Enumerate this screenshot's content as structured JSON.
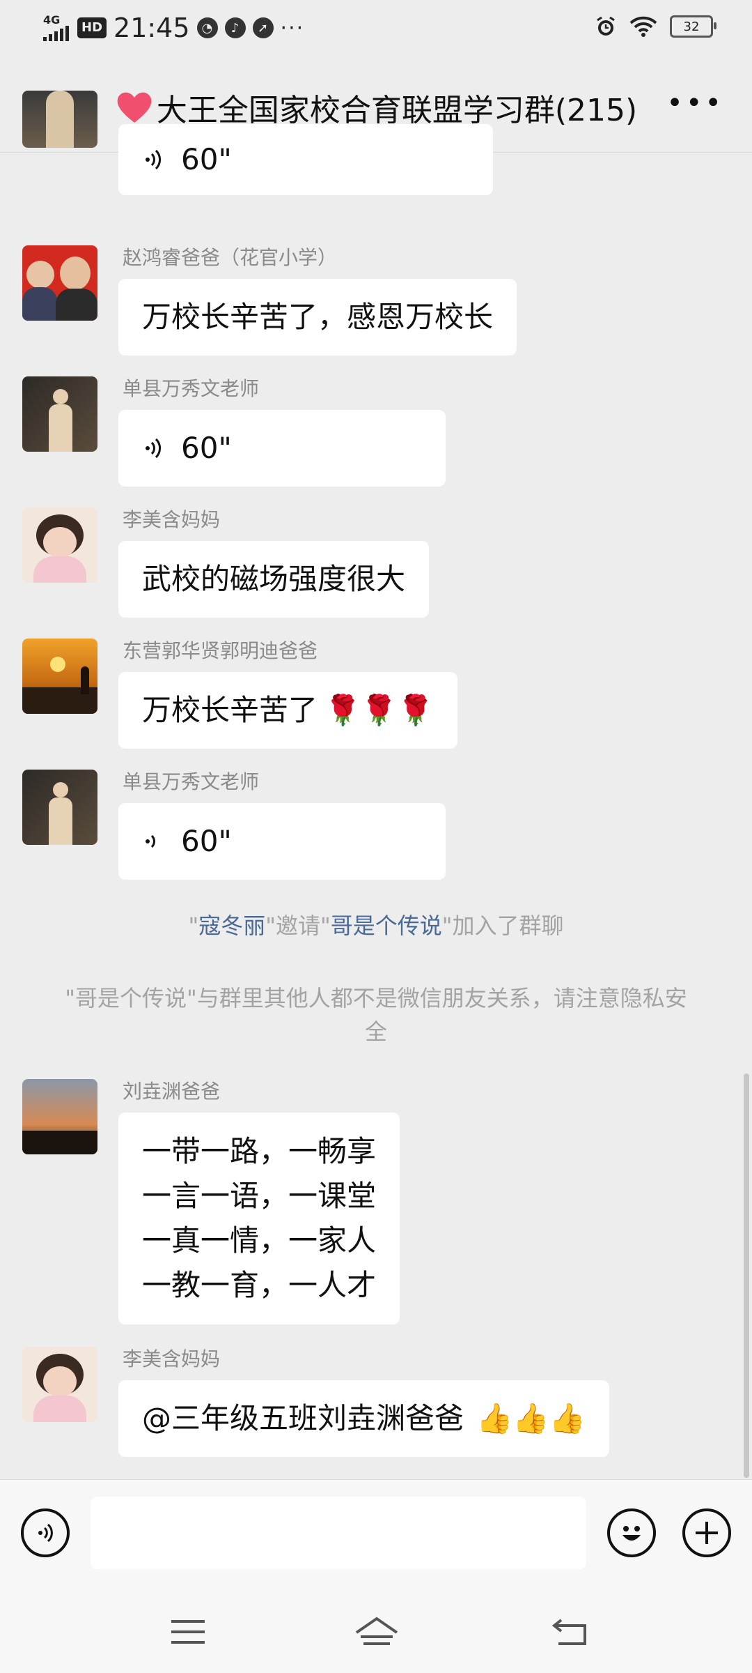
{
  "status_bar": {
    "network": "4G",
    "hd": "HD",
    "time": "21:45",
    "more": "···",
    "battery": "32"
  },
  "header": {
    "title": "大王全国家校合育联盟学习群(215)",
    "heart_color": "#f0506e"
  },
  "messages": [
    {
      "voice_duration": "60\""
    },
    {
      "sender": "赵鸿睿爸爸（花官小学）",
      "text": "万校长辛苦了，感恩万校长"
    },
    {
      "sender": "单县万秀文老师",
      "voice_duration": "60\""
    },
    {
      "sender": "李美含妈妈",
      "text": "武校的磁场强度很大"
    },
    {
      "sender": "东营郭华贤郭明迪爸爸",
      "text": "万校长辛苦了",
      "emoji": "🌹🌹🌹"
    },
    {
      "sender": "单县万秀文老师",
      "voice_duration": "60\""
    },
    {
      "sender": "刘垚渊爸爸",
      "lines": [
        "一带一路，一畅享",
        "一言一语，一课堂",
        "一真一情，一家人",
        "一教一育，一人才"
      ]
    },
    {
      "sender": "李美含妈妈",
      "text": "@三年级五班刘垚渊爸爸",
      "emoji": "👍👍👍"
    }
  ],
  "system_notices": {
    "invite": {
      "q1": "\"",
      "inviter": "寇冬丽",
      "mid": "\"邀请\"",
      "invitee": "哥是个传说",
      "end": "\"加入了群聊"
    },
    "privacy": "\"哥是个传说\"与群里其他人都不是微信朋友关系，请注意隐私安全"
  },
  "input_bar": {
    "placeholder": ""
  }
}
